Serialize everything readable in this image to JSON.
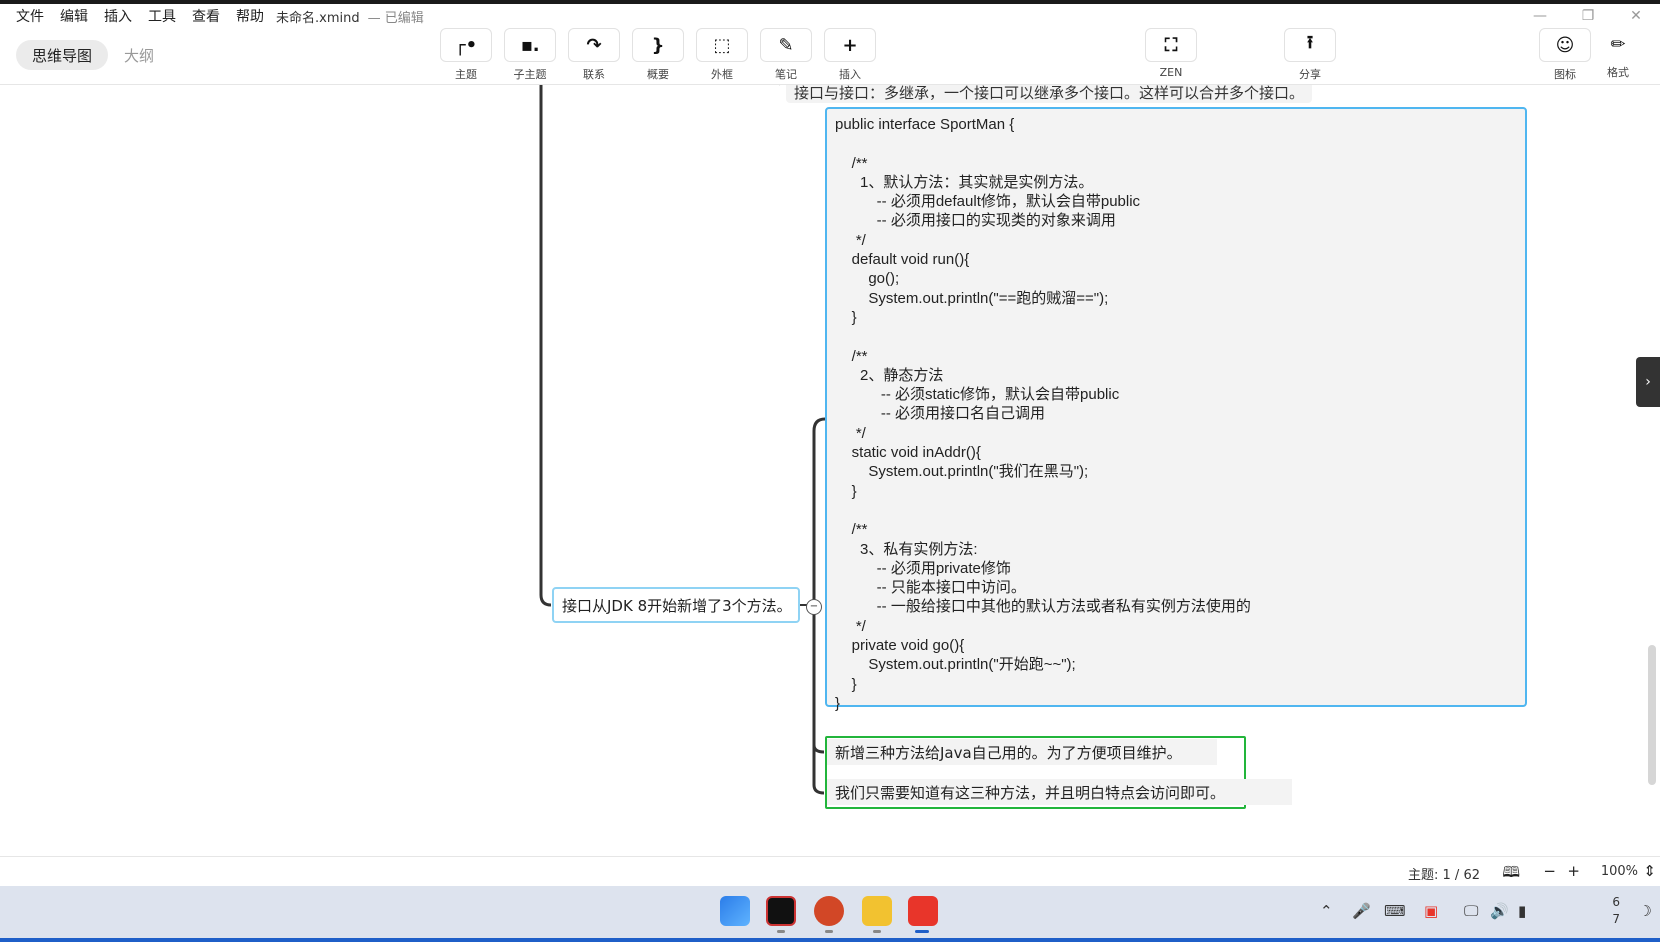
{
  "menu": [
    "文件",
    "编辑",
    "插入",
    "工具",
    "查看",
    "帮助"
  ],
  "file_name": "未命名.xmind",
  "edit_status": "— 已编辑",
  "view_tabs": {
    "mindmap": "思维导图",
    "outline": "大纲"
  },
  "toolbar": {
    "topic": "主题",
    "subtopic": "子主题",
    "relation": "联系",
    "summary": "概要",
    "boundary": "外框",
    "note": "笔记",
    "insert": "插入",
    "zen": "ZEN",
    "share": "分享",
    "icon": "图标",
    "format": "格式"
  },
  "canvas": {
    "top_node": "接口与接口：多继承，一个接口可以继承多个接口。这样可以合并多个接口。",
    "main_node": "接口从JDK 8开始新增了3个方法。",
    "code_lines": [
      "public interface SportMan {",
      "",
      "    /**",
      "      1、默认方法：其实就是实例方法。",
      "          -- 必须用default修饰，默认会自带public",
      "          -- 必须用接口的实现类的对象来调用",
      "     */",
      "    default void run(){",
      "        go();",
      "        System.out.println(\"==跑的贼溜==\");",
      "    }",
      "",
      "    /**",
      "      2、静态方法",
      "           -- 必须static修饰，默认会自带public",
      "           -- 必须用接口名自己调用",
      "     */",
      "    static void inAddr(){",
      "        System.out.println(\"我们在黑马\");",
      "    }",
      "",
      "    /**",
      "      3、私有实例方法:",
      "          -- 必须用private修饰",
      "          -- 只能本接口中访问。",
      "          -- 一般给接口中其他的默认方法或者私有实例方法使用的",
      "     */",
      "    private void go(){",
      "        System.out.println(\"开始跑~~\");",
      "    }",
      "}"
    ],
    "note_line1": "新增三种方法给Java自己用的。为了方便项目维护。",
    "note_line2": "我们只需要知道有这三种方法，并且明白特点会访问即可。"
  },
  "statusbar": {
    "topic_count": "主题: 1 / 62",
    "zoom": "100%"
  },
  "taskbar": {
    "clock_line1": "6",
    "clock_line2": "7"
  }
}
